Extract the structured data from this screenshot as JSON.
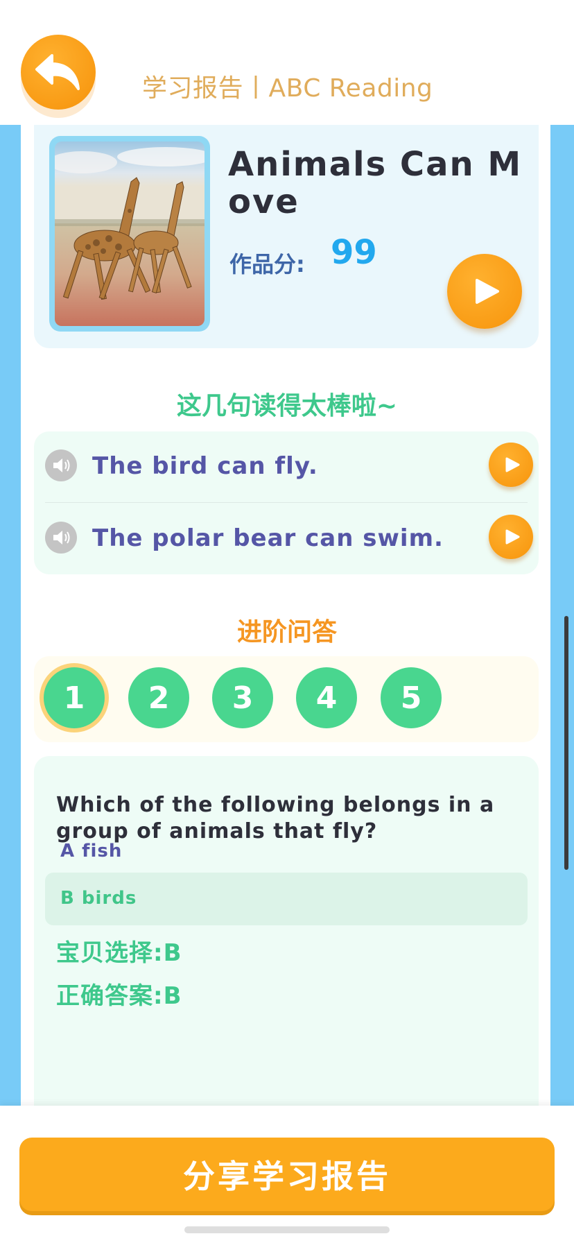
{
  "header": {
    "title": "学习报告丨ABC Reading",
    "back_icon": "back-arrow-icon"
  },
  "book": {
    "title": "Animals Can Move",
    "score_label": "作品分:",
    "score_value": "99",
    "cover_image": "giraffes-running"
  },
  "good_sentences": {
    "title": "这几句读得太棒啦~",
    "items": [
      {
        "text": "The bird can fly."
      },
      {
        "text": "The polar bear can swim."
      }
    ]
  },
  "advanced_qa": {
    "title": "进阶问答",
    "numbers": [
      "1",
      "2",
      "3",
      "4",
      "5"
    ],
    "selected": "1",
    "question": "Which of the following belongs in a group of animals that fly?",
    "options": [
      {
        "label": "A fish"
      },
      {
        "label": "B birds"
      }
    ],
    "child_choice": "宝贝选择:B",
    "correct_answer": "正确答案:B"
  },
  "footer": {
    "share_label": "分享学习报告"
  },
  "colors": {
    "orange": "#f7940b",
    "green": "#49d68f",
    "blue_side": "#78cbf7",
    "score_blue": "#22a8ee"
  }
}
